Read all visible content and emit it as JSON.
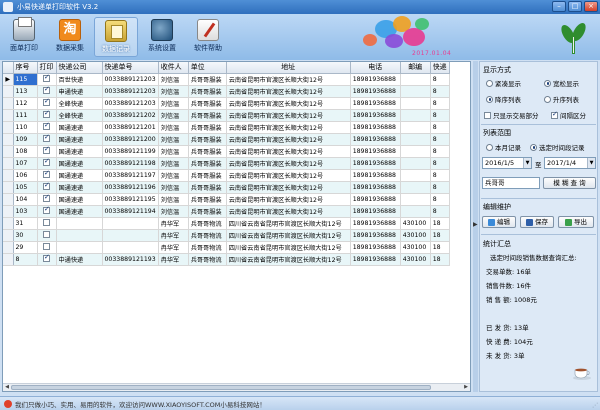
{
  "window": {
    "title": "小易快递单打印软件 V3.2",
    "minimize": "–",
    "maximize": "□",
    "close": "×"
  },
  "toolbar": {
    "items": [
      {
        "label": "面单打印",
        "icon": "printer-icon"
      },
      {
        "label": "数据采集",
        "icon": "collect-icon",
        "glyph": "淘"
      },
      {
        "label": "数据记录",
        "icon": "record-icon",
        "active": true
      },
      {
        "label": "系统设置",
        "icon": "settings-icon"
      },
      {
        "label": "软件帮助",
        "icon": "help-icon"
      }
    ],
    "date": "2017.01.04"
  },
  "grid": {
    "columns": [
      "序号",
      "打印",
      "快递公司",
      "快递单号",
      "收件人",
      "单位",
      "地址",
      "电话",
      "邮编",
      "快递"
    ],
    "rows": [
      {
        "seq": "115",
        "printed": true,
        "company": "百世快递",
        "tracking": "0033889121203",
        "recipient": "刘信温",
        "unit": "兵哥哥服装",
        "address": "云南省昆明市官渡区长顺大街12号",
        "phone": "18981936888",
        "zip": "",
        "extra": "8"
      },
      {
        "seq": "113",
        "printed": true,
        "company": "申通快递",
        "tracking": "0033889121203",
        "recipient": "刘信温",
        "unit": "兵哥哥服装",
        "address": "云南省昆明市官渡区长顺大街12号",
        "phone": "18981936888",
        "zip": "",
        "extra": "8"
      },
      {
        "seq": "112",
        "printed": true,
        "company": "全峰快递",
        "tracking": "0033889121203",
        "recipient": "刘信温",
        "unit": "兵哥哥服装",
        "address": "云南省昆明市官渡区长顺大街12号",
        "phone": "18981936888",
        "zip": "",
        "extra": "8"
      },
      {
        "seq": "111",
        "printed": true,
        "company": "全峰快递",
        "tracking": "0033889121202",
        "recipient": "刘信温",
        "unit": "兵哥哥服装",
        "address": "云南省昆明市官渡区长顺大街12号",
        "phone": "18981936888",
        "zip": "",
        "extra": "8"
      },
      {
        "seq": "110",
        "printed": true,
        "company": "国通速递",
        "tracking": "0033889121201",
        "recipient": "刘信温",
        "unit": "兵哥哥服装",
        "address": "云南省昆明市官渡区长顺大街12号",
        "phone": "18981936888",
        "zip": "",
        "extra": "8"
      },
      {
        "seq": "109",
        "printed": true,
        "company": "国通速递",
        "tracking": "0033889121200",
        "recipient": "刘信温",
        "unit": "兵哥哥服装",
        "address": "云南省昆明市官渡区长顺大街12号",
        "phone": "18981936888",
        "zip": "",
        "extra": "8"
      },
      {
        "seq": "108",
        "printed": true,
        "company": "国通速递",
        "tracking": "0033889121199",
        "recipient": "刘信温",
        "unit": "兵哥哥服装",
        "address": "云南省昆明市官渡区长顺大街12号",
        "phone": "18981936888",
        "zip": "",
        "extra": "8"
      },
      {
        "seq": "107",
        "printed": true,
        "company": "国通速递",
        "tracking": "0033889121198",
        "recipient": "刘信温",
        "unit": "兵哥哥服装",
        "address": "云南省昆明市官渡区长顺大街12号",
        "phone": "18981936888",
        "zip": "",
        "extra": "8"
      },
      {
        "seq": "106",
        "printed": true,
        "company": "国通速递",
        "tracking": "0033889121197",
        "recipient": "刘信温",
        "unit": "兵哥哥服装",
        "address": "云南省昆明市官渡区长顺大街12号",
        "phone": "18981936888",
        "zip": "",
        "extra": "8"
      },
      {
        "seq": "105",
        "printed": true,
        "company": "国通速递",
        "tracking": "0033889121196",
        "recipient": "刘信温",
        "unit": "兵哥哥服装",
        "address": "云南省昆明市官渡区长顺大街12号",
        "phone": "18981936888",
        "zip": "",
        "extra": "8"
      },
      {
        "seq": "104",
        "printed": true,
        "company": "国通速递",
        "tracking": "0033889121195",
        "recipient": "刘信温",
        "unit": "兵哥哥服装",
        "address": "云南省昆明市官渡区长顺大街12号",
        "phone": "18981936888",
        "zip": "",
        "extra": "8"
      },
      {
        "seq": "103",
        "printed": true,
        "company": "国通速递",
        "tracking": "0033889121194",
        "recipient": "刘信温",
        "unit": "兵哥哥服装",
        "address": "云南省昆明市官渡区长顺大街12号",
        "phone": "18981936888",
        "zip": "",
        "extra": "8"
      },
      {
        "seq": "31",
        "printed": false,
        "company": "",
        "tracking": "",
        "recipient": "冉华军",
        "unit": "兵哥哥物流",
        "address": "四川省云南省昆明市官渡区长顺大街12号",
        "phone": "18981936888",
        "zip": "430100",
        "extra": "18"
      },
      {
        "seq": "30",
        "printed": false,
        "company": "",
        "tracking": "",
        "recipient": "冉华军",
        "unit": "兵哥哥物流",
        "address": "四川省云南省昆明市官渡区长顺大街12号",
        "phone": "18981936888",
        "zip": "430100",
        "extra": "18"
      },
      {
        "seq": "29",
        "printed": false,
        "company": "",
        "tracking": "",
        "recipient": "冉华军",
        "unit": "兵哥哥物流",
        "address": "四川省云南省昆明市官渡区长顺大街12号",
        "phone": "18981936888",
        "zip": "430100",
        "extra": "18"
      },
      {
        "seq": "8",
        "printed": true,
        "company": "中通快递",
        "tracking": "0033889121193",
        "recipient": "冉华军",
        "unit": "兵哥哥物流",
        "address": "四川省云南省昆明市官渡区长顺大街12号",
        "phone": "18981936888",
        "zip": "430100",
        "extra": "18"
      }
    ],
    "current_row_marker": "▶"
  },
  "splitter": {
    "arrow": "▶"
  },
  "panel": {
    "display": {
      "title": "显示方式",
      "compact": "紧凑显示",
      "wide": "宽松显示",
      "desc": "降序列表",
      "asc": "升序列表",
      "only_trade": "只显示交易部分",
      "separate": "间隔区分"
    },
    "list": {
      "title": "列表范围",
      "this_month": "本月记录",
      "selected_period": "选定时间段记录",
      "date_from": "2016/1/5",
      "to": "至",
      "date_to": "2017/1/4",
      "keyword": "兵哥哥",
      "fuzzy_query": "模 糊 查 询"
    },
    "edit": {
      "title": "编辑维护",
      "edit": "编辑",
      "save": "保存",
      "export": "导出"
    },
    "stats": {
      "title": "统计汇总",
      "caption": "选定时间段销售数据查询汇总:",
      "trade_count": "交易单数: 16单",
      "sales_qty": "销售件数: 16件",
      "sales_amount": "销 售 额: 1008元",
      "shipped": "已 发 货: 13单",
      "freight": "快 递 费: 104元",
      "unshipped": "未 发 货: 3单"
    }
  },
  "statusbar": {
    "text": "我们只做小巧、实用、易用的软件，欢迎访问WWW.XIAOYISOFT.COM小易科技网站！"
  },
  "colors": {
    "accent": "#2f6fbd",
    "selection": "#2f6fd0",
    "alt_row": "#e8f6f8"
  }
}
